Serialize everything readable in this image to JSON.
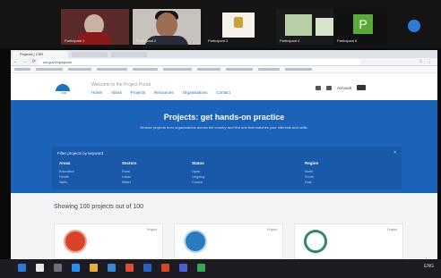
{
  "call": {
    "participants": [
      {
        "name": "Participant 1"
      },
      {
        "name": "Participant 2"
      },
      {
        "name": "Participant 3"
      },
      {
        "name": "Participant 4"
      },
      {
        "name": "Participant 5",
        "initial": "P"
      }
    ]
  },
  "browser": {
    "tab_title": "Projects | CSR",
    "url": "csr.gov.in/projects",
    "nav_glyphs": "← → ⟳",
    "icon_glyphs": "☆ ⋮"
  },
  "site": {
    "logo_text": "CSR",
    "title": "Welcome to the Project Portal",
    "nav": [
      "Home",
      "About",
      "Projects",
      "Resources",
      "Organisations",
      "Contact"
    ],
    "account_label": "Account"
  },
  "hero": {
    "title": "Projects: get hands-on practice",
    "subtitle": "Browse projects from organisations across the country and find one that matches your interests and skills.",
    "filter_label": "Filter projects by keyword",
    "close_glyph": "×",
    "filters": [
      {
        "heading": "Areas",
        "items": [
          "Education",
          "Health",
          "Skills"
        ]
      },
      {
        "heading": "Sectors",
        "items": [
          "Rural",
          "Urban",
          "Water"
        ]
      },
      {
        "heading": "Status",
        "items": [
          "Open",
          "Ongoing",
          "Closed"
        ]
      },
      {
        "heading": "Region",
        "items": [
          "North",
          "South",
          "East"
        ]
      }
    ]
  },
  "results": {
    "count_text": "Showing 100 projects out of 100",
    "cards": [
      {
        "badge": "Project"
      },
      {
        "badge": "Project"
      },
      {
        "badge": "Project"
      }
    ]
  },
  "taskbar": {
    "tray_text": "ENG"
  },
  "colors": {
    "hero_blue": "#1b62b8",
    "accent_blue": "#1e73be",
    "call_button": "#2e7bd6"
  }
}
